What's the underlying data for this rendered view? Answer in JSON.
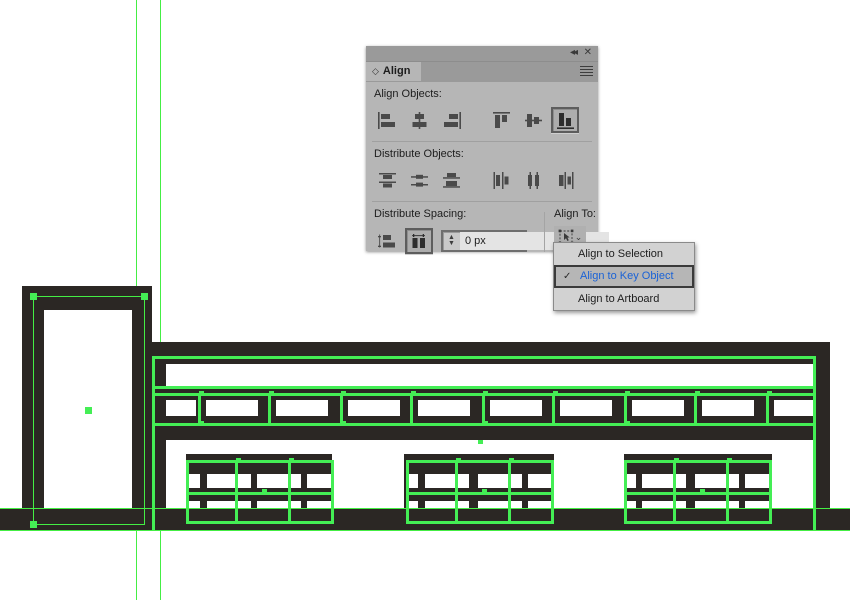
{
  "app": {
    "canvas_background": "#ffffff",
    "artwork_color": "#2b2724",
    "selection_color": "#44ee55",
    "guide_color": "#44ee44"
  },
  "panel": {
    "title": "Align",
    "tab_toggle_icon": "double-arrow-toggle-icon",
    "collapse_icon": "◂◂",
    "close_icon": "✕",
    "menu_icon": "panel-menu-icon",
    "sections": {
      "align_objects": {
        "label": "Align Objects:",
        "buttons": [
          {
            "name": "horizontal-align-left",
            "icon": "align-left-icon",
            "active": false
          },
          {
            "name": "horizontal-align-center",
            "icon": "align-hcenter-icon",
            "active": false
          },
          {
            "name": "horizontal-align-right",
            "icon": "align-right-icon",
            "active": false
          },
          {
            "name": "vertical-align-top",
            "icon": "align-top-icon",
            "active": false
          },
          {
            "name": "vertical-align-center",
            "icon": "align-vcenter-icon",
            "active": false
          },
          {
            "name": "vertical-align-bottom",
            "icon": "align-bottom-icon",
            "active": true
          }
        ]
      },
      "distribute_objects": {
        "label": "Distribute Objects:",
        "buttons": [
          {
            "name": "vertical-distribute-top",
            "icon": "distribute-top-icon",
            "active": false
          },
          {
            "name": "vertical-distribute-center",
            "icon": "distribute-vcenter-icon",
            "active": false
          },
          {
            "name": "vertical-distribute-bottom",
            "icon": "distribute-bottom-icon",
            "active": false
          },
          {
            "name": "horizontal-distribute-left",
            "icon": "distribute-left-icon",
            "active": false
          },
          {
            "name": "horizontal-distribute-center",
            "icon": "distribute-hcenter-icon",
            "active": false
          },
          {
            "name": "horizontal-distribute-right",
            "icon": "distribute-right-icon",
            "active": false
          }
        ]
      },
      "distribute_spacing": {
        "label": "Distribute Spacing:",
        "buttons": [
          {
            "name": "vertical-distribute-space",
            "icon": "vspace-icon",
            "active": false
          },
          {
            "name": "horizontal-distribute-space",
            "icon": "hspace-icon",
            "active": true
          }
        ],
        "value": "0 px",
        "placeholder": "0 px"
      },
      "align_to": {
        "label": "Align To:",
        "selected_icon": "align-to-key-object-icon",
        "chevron": "⌄"
      }
    }
  },
  "dropdown": {
    "items": [
      {
        "label": "Align to Selection",
        "selected": false,
        "check": ""
      },
      {
        "label": "Align to Key Object",
        "selected": true,
        "check": "✓"
      },
      {
        "label": "Align to Artboard",
        "selected": false,
        "check": ""
      }
    ],
    "highlight_text_color": "#1a62d6"
  }
}
